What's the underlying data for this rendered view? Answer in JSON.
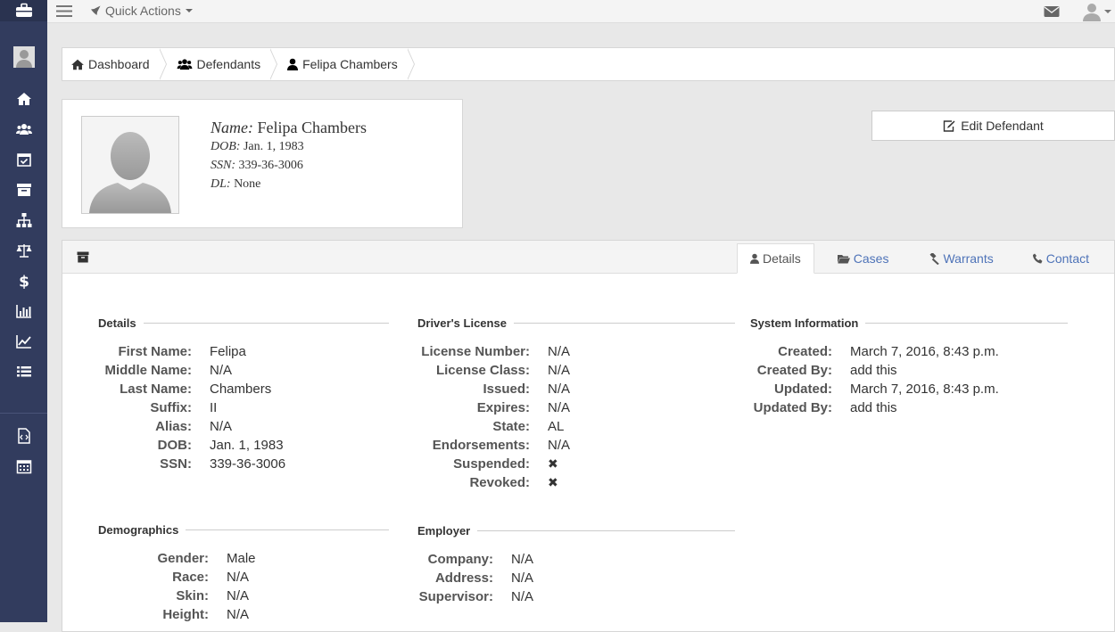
{
  "topbar": {
    "quick_actions": "Quick Actions"
  },
  "breadcrumb": [
    {
      "label": "Dashboard",
      "icon": "home-icon"
    },
    {
      "label": "Defendants",
      "icon": "users-icon"
    },
    {
      "label": "Felipa Chambers",
      "icon": "user-icon"
    }
  ],
  "profile": {
    "name_label": "Name:",
    "name": "Felipa Chambers",
    "dob_label": "DOB:",
    "dob": "Jan. 1, 1983",
    "ssn_label": "SSN:",
    "ssn": "339-36-3006",
    "dl_label": "DL:",
    "dl": "None"
  },
  "edit_button": "Edit Defendant",
  "tabs": [
    {
      "label": "Details",
      "icon": "user-icon",
      "active": true
    },
    {
      "label": "Cases",
      "icon": "folder-open-icon",
      "active": false
    },
    {
      "label": "Warrants",
      "icon": "gavel-icon",
      "active": false
    },
    {
      "label": "Contact",
      "icon": "phone-icon",
      "active": false
    }
  ],
  "details": {
    "title": "Details",
    "rows": [
      {
        "k": "First Name:",
        "v": "Felipa"
      },
      {
        "k": "Middle Name:",
        "v": "N/A"
      },
      {
        "k": "Last Name:",
        "v": "Chambers"
      },
      {
        "k": "Suffix:",
        "v": "II"
      },
      {
        "k": "Alias:",
        "v": "N/A"
      },
      {
        "k": "DOB:",
        "v": "Jan. 1, 1983"
      },
      {
        "k": "SSN:",
        "v": "339-36-3006"
      }
    ]
  },
  "license": {
    "title": "Driver's License",
    "rows": [
      {
        "k": "License Number:",
        "v": "N/A"
      },
      {
        "k": "License Class:",
        "v": "N/A"
      },
      {
        "k": "Issued:",
        "v": "N/A"
      },
      {
        "k": "Expires:",
        "v": "N/A"
      },
      {
        "k": "State:",
        "v": "AL"
      },
      {
        "k": "Endorsements:",
        "v": "N/A"
      },
      {
        "k": "Suspended:",
        "v": "✖"
      },
      {
        "k": "Revoked:",
        "v": "✖"
      }
    ]
  },
  "system": {
    "title": "System Information",
    "rows": [
      {
        "k": "Created:",
        "v": "March 7, 2016, 8:43 p.m."
      },
      {
        "k": "Created By:",
        "v": "add this"
      },
      {
        "k": "Updated:",
        "v": "March 7, 2016, 8:43 p.m."
      },
      {
        "k": "Updated By:",
        "v": "add this"
      }
    ]
  },
  "demographics": {
    "title": "Demographics",
    "rows": [
      {
        "k": "Gender:",
        "v": "Male"
      },
      {
        "k": "Race:",
        "v": "N/A"
      },
      {
        "k": "Skin:",
        "v": "N/A"
      },
      {
        "k": "Height:",
        "v": "N/A"
      }
    ]
  },
  "employer": {
    "title": "Employer",
    "rows": [
      {
        "k": "Company:",
        "v": "N/A"
      },
      {
        "k": "Address:",
        "v": "N/A"
      },
      {
        "k": "Supervisor:",
        "v": "N/A"
      }
    ]
  }
}
